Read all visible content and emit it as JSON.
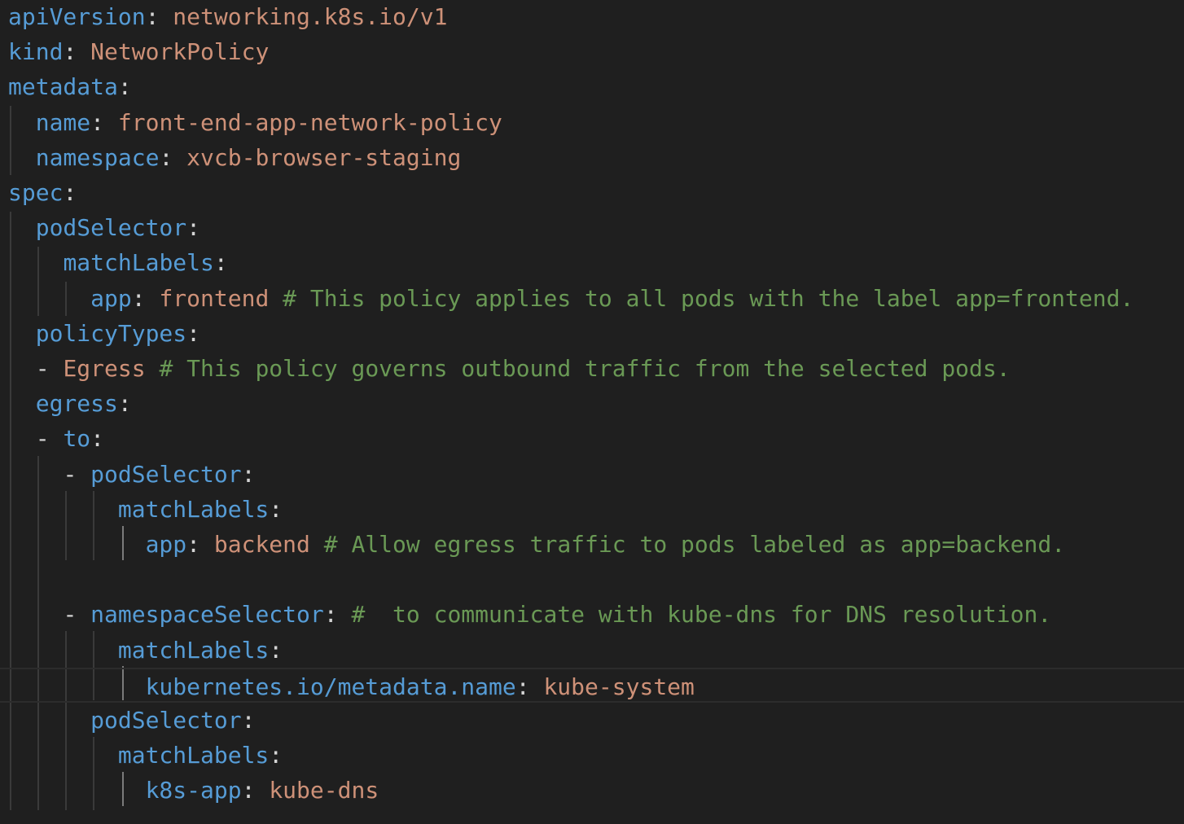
{
  "editor": {
    "lines": [
      {
        "indent": "",
        "dash": "",
        "key": "apiVersion",
        "sep": ": ",
        "value": "networking.k8s.io/v1",
        "comment": ""
      },
      {
        "indent": "",
        "dash": "",
        "key": "kind",
        "sep": ": ",
        "value": "NetworkPolicy",
        "comment": ""
      },
      {
        "indent": "",
        "dash": "",
        "key": "metadata",
        "sep": ":",
        "value": "",
        "comment": ""
      },
      {
        "indent": "  ",
        "dash": "",
        "key": "name",
        "sep": ": ",
        "value": "front-end-app-network-policy",
        "comment": ""
      },
      {
        "indent": "  ",
        "dash": "",
        "key": "namespace",
        "sep": ": ",
        "value": "xvcb-browser-staging",
        "comment": ""
      },
      {
        "indent": "",
        "dash": "",
        "key": "spec",
        "sep": ":",
        "value": "",
        "comment": ""
      },
      {
        "indent": "  ",
        "dash": "",
        "key": "podSelector",
        "sep": ":",
        "value": "",
        "comment": ""
      },
      {
        "indent": "    ",
        "dash": "",
        "key": "matchLabels",
        "sep": ":",
        "value": "",
        "comment": ""
      },
      {
        "indent": "      ",
        "dash": "",
        "key": "app",
        "sep": ": ",
        "value": "frontend",
        "comment": " # This policy applies to all pods with the label app=frontend."
      },
      {
        "indent": "  ",
        "dash": "",
        "key": "policyTypes",
        "sep": ":",
        "value": "",
        "comment": ""
      },
      {
        "indent": "  ",
        "dash": "- ",
        "key": "",
        "sep": "",
        "value": "Egress",
        "comment": " # This policy governs outbound traffic from the selected pods."
      },
      {
        "indent": "  ",
        "dash": "",
        "key": "egress",
        "sep": ":",
        "value": "",
        "comment": ""
      },
      {
        "indent": "  ",
        "dash": "- ",
        "key": "to",
        "sep": ":",
        "value": "",
        "comment": ""
      },
      {
        "indent": "    ",
        "dash": "- ",
        "key": "podSelector",
        "sep": ":",
        "value": "",
        "comment": ""
      },
      {
        "indent": "        ",
        "dash": "",
        "key": "matchLabels",
        "sep": ":",
        "value": "",
        "comment": ""
      },
      {
        "indent": "          ",
        "dash": "",
        "key": "app",
        "sep": ": ",
        "value": "backend",
        "comment": " # Allow egress traffic to pods labeled as app=backend."
      },
      {
        "indent": "",
        "dash": "",
        "key": "",
        "sep": "",
        "value": "",
        "comment": ""
      },
      {
        "indent": "    ",
        "dash": "- ",
        "key": "namespaceSelector",
        "sep": ":",
        "value": "",
        "comment": " #  to communicate with kube-dns for DNS resolution."
      },
      {
        "indent": "        ",
        "dash": "",
        "key": "matchLabels",
        "sep": ":",
        "value": "",
        "comment": ""
      },
      {
        "indent": "          ",
        "dash": "",
        "key": "kubernetes.io/metadata.name",
        "sep": ": ",
        "value": "kube-system",
        "comment": ""
      },
      {
        "indent": "      ",
        "dash": "",
        "key": "podSelector",
        "sep": ":",
        "value": "",
        "comment": ""
      },
      {
        "indent": "        ",
        "dash": "",
        "key": "matchLabels",
        "sep": ":",
        "value": "",
        "comment": ""
      },
      {
        "indent": "          ",
        "dash": "",
        "key": "k8s-app",
        "sep": ": ",
        "value": "kube-dns",
        "comment": ""
      }
    ]
  }
}
